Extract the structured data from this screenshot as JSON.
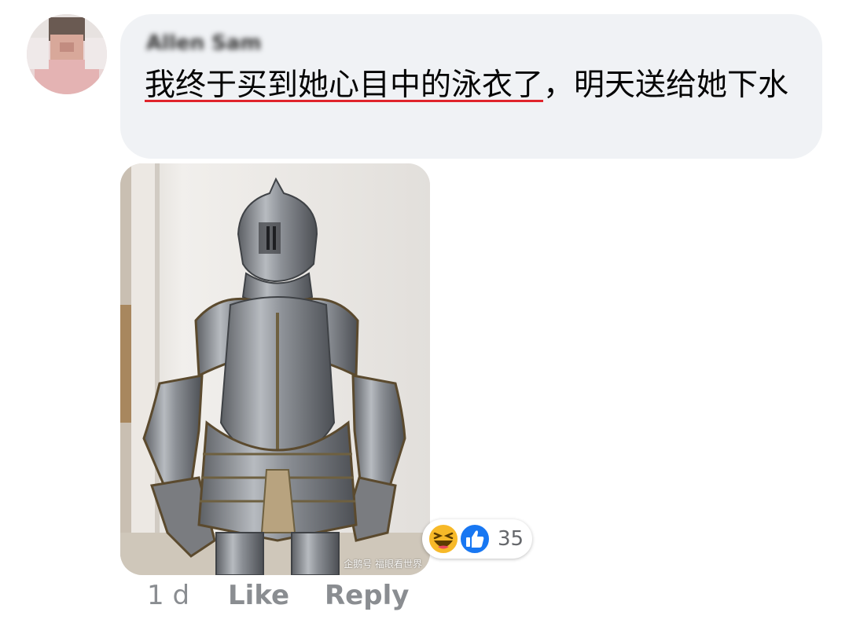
{
  "comment": {
    "author_name": "Allen Sam",
    "text_underlined": "我终于买到她心目中的泳衣了",
    "text_rest": "，明天送给她下水",
    "image_watermark": "企鹅号 福眼看世界"
  },
  "reactions": {
    "icons": [
      "laughing-emoji-icon",
      "thumbs-up-icon"
    ],
    "count": "35"
  },
  "actions": {
    "time": "1 d",
    "like_label": "Like",
    "reply_label": "Reply"
  },
  "colors": {
    "bubble_bg": "#f0f2f5",
    "underline": "#e0242c",
    "like_blue": "#1877f2",
    "haha_yellow": "#f7b928",
    "action_gray": "#8a8d91"
  }
}
